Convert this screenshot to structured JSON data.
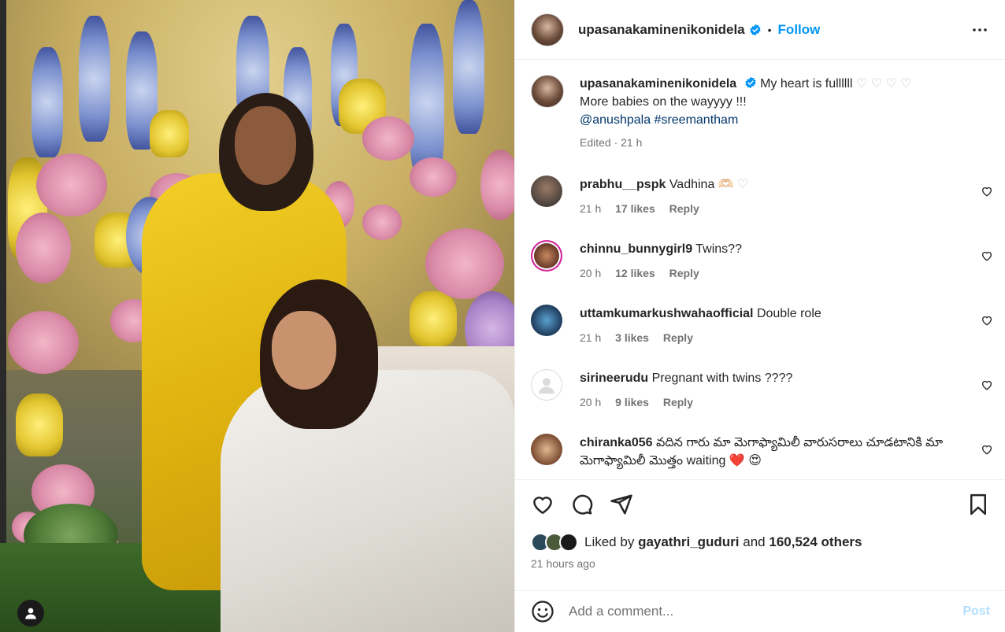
{
  "header": {
    "username": "upasanakaminenikonidela",
    "separator": "•",
    "follow_label": "Follow"
  },
  "caption": {
    "username": "upasanakaminenikonidela",
    "line1": "My heart is fullllll",
    "hearts": "♡ ♡ ♡ ♡",
    "line2": "More babies on the wayyyy !!!",
    "mention": "@anushpala",
    "hashtag": "#sreemantham",
    "meta": "Edited · 21 h"
  },
  "comments": [
    {
      "username": "prabhu__pspk",
      "text": "Vadhina",
      "emoji": "🫶🏻 ♡",
      "time": "21 h",
      "likes": "17 likes",
      "reply": "Reply",
      "avatar_color": "#3b3b3b"
    },
    {
      "username": "chinnu_bunnygirl9",
      "text": "Twins??",
      "emoji": "",
      "time": "20 h",
      "likes": "12 likes",
      "reply": "Reply",
      "avatar_color": "#8a5a3a"
    },
    {
      "username": "uttamkumarkushwahaofficial",
      "text": "Double role",
      "emoji": "",
      "time": "21 h",
      "likes": "3 likes",
      "reply": "Reply",
      "avatar_color": "#2e5f8a"
    },
    {
      "username": "sirineerudu",
      "text": "Pregnant with twins ????",
      "emoji": "",
      "time": "20 h",
      "likes": "9 likes",
      "reply": "Reply",
      "avatar_color": "#dbdbdb"
    },
    {
      "username": "chiranka056",
      "text": "వదిన గారు మా మెగాఫ్యామిలీ వారుసరాలు చూడటానికి మా మెగాఫ్యామిలీ మొత్తం waiting",
      "emoji": "❤️ 😍",
      "time": "",
      "likes": "",
      "reply": "",
      "avatar_color": "#c98a60"
    }
  ],
  "likes": {
    "prefix": "Liked by",
    "user": "gayathri_guduri",
    "and": "and",
    "others": "160,524 others"
  },
  "time_ago": "21 hours ago",
  "add_comment": {
    "placeholder": "Add a comment...",
    "post_label": "Post"
  },
  "colors": {
    "accent": "#0095f6",
    "post_disabled": "#b2dffc",
    "link": "#00376b"
  }
}
